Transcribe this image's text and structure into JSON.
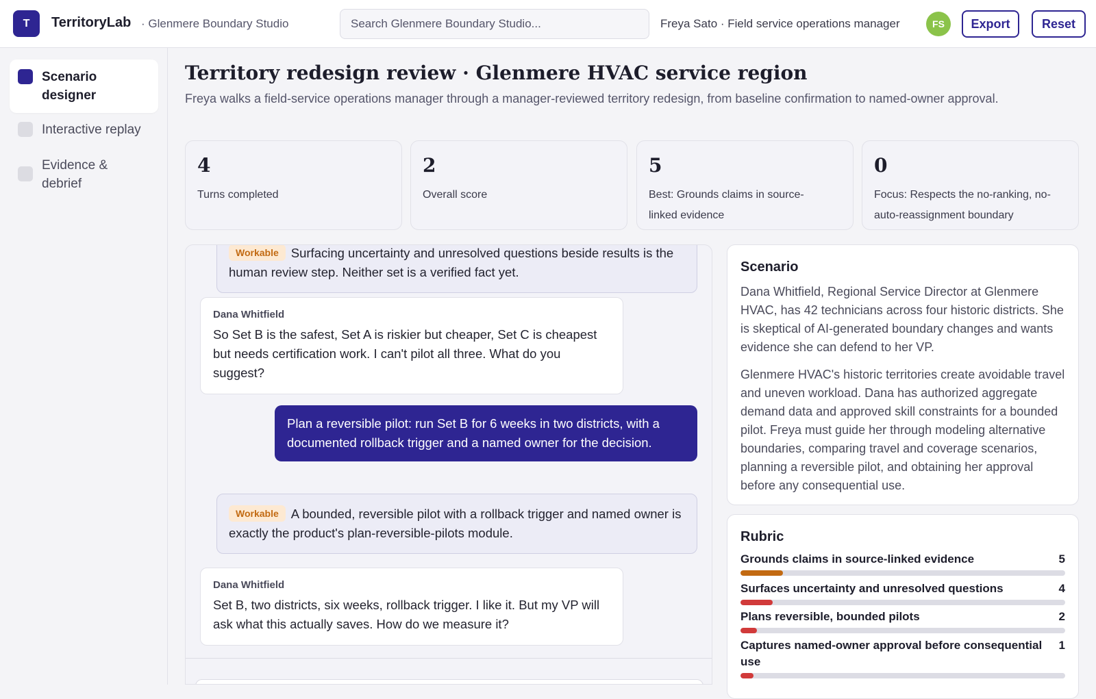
{
  "header": {
    "logo_letter": "T",
    "app_name": "TerritoryLab",
    "studio": "· Glenmere Boundary Studio",
    "search_placeholder": "Search Glenmere Boundary Studio...",
    "user_label": "Freya Sato · Field service operations manager",
    "avatar_initials": "FS",
    "export_label": "Export",
    "reset_label": "Reset"
  },
  "sidebar": {
    "items": [
      {
        "label": "Scenario designer",
        "active": true
      },
      {
        "label": "Interactive replay",
        "active": false
      },
      {
        "label": "Evidence & debrief",
        "active": false
      }
    ]
  },
  "page": {
    "title": "Territory redesign review · Glenmere HVAC service region",
    "subtitle": "Freya walks a field-service operations manager through a manager-reviewed territory redesign, from baseline confirmation to named-owner approval."
  },
  "stats": [
    {
      "value": "4",
      "label": "Turns completed"
    },
    {
      "value": "2",
      "label": "Overall score"
    },
    {
      "value": "5",
      "label": "Best: Grounds claims in source-linked evidence"
    },
    {
      "value": "0",
      "label": "Focus: Respects the no-ranking, no-auto-reassignment boundary"
    }
  ],
  "chat": {
    "messages": [
      {
        "kind": "eval",
        "badge": "Workable",
        "text": "Surfacing uncertainty and unresolved questions beside results is the human review step. Neither set is a verified fact yet."
      },
      {
        "kind": "peer",
        "author": "Dana Whitfield",
        "text": "So Set B is the safest, Set A is riskier but cheaper, Set C is cheapest but needs certification work. I can't pilot all three. What do you suggest?"
      },
      {
        "kind": "mine",
        "text": "Plan a reversible pilot: run Set B for 6 weeks in two districts, with a documented rollback trigger and a named owner for the decision."
      },
      {
        "kind": "eval",
        "badge": "Workable",
        "text": "A bounded, reversible pilot with a rollback trigger and named owner is exactly the product's plan-reversible-pilots module."
      },
      {
        "kind": "peer",
        "author": "Dana Whitfield",
        "text": "Set B, two districts, six weeks, rollback trigger. I like it. But my VP will ask what this actually saves. How do we measure it?"
      }
    ]
  },
  "scenario": {
    "title": "Scenario",
    "paragraph1": "Dana Whitfield, Regional Service Director at Glenmere HVAC, has 42 technicians across four historic districts. She is skeptical of AI-generated boundary changes and wants evidence she can defend to her VP.",
    "paragraph2": "Glenmere HVAC's historic territories create avoidable travel and uneven workload. Dana has authorized aggregate demand data and approved skill constraints for a bounded pilot. Freya must guide her through modeling alternative boundaries, comparing travel and coverage scenarios, planning a reversible pilot, and obtaining her approval before any consequential use."
  },
  "rubric": {
    "title": "Rubric",
    "max_score": 5,
    "items": [
      {
        "name": "Grounds claims in source-linked evidence",
        "score": 5,
        "level": 0.13,
        "color": "#c26a12"
      },
      {
        "name": "Surfaces uncertainty and unresolved questions",
        "score": 4,
        "level": 0.1,
        "color": "#d13a3a"
      },
      {
        "name": "Plans reversible, bounded pilots",
        "score": 2,
        "level": 0.05,
        "color": "#d13a3a"
      },
      {
        "name": "Captures named-owner approval before consequential use",
        "score": 1,
        "level": 0.04,
        "color": "#d13a3a"
      }
    ]
  }
}
